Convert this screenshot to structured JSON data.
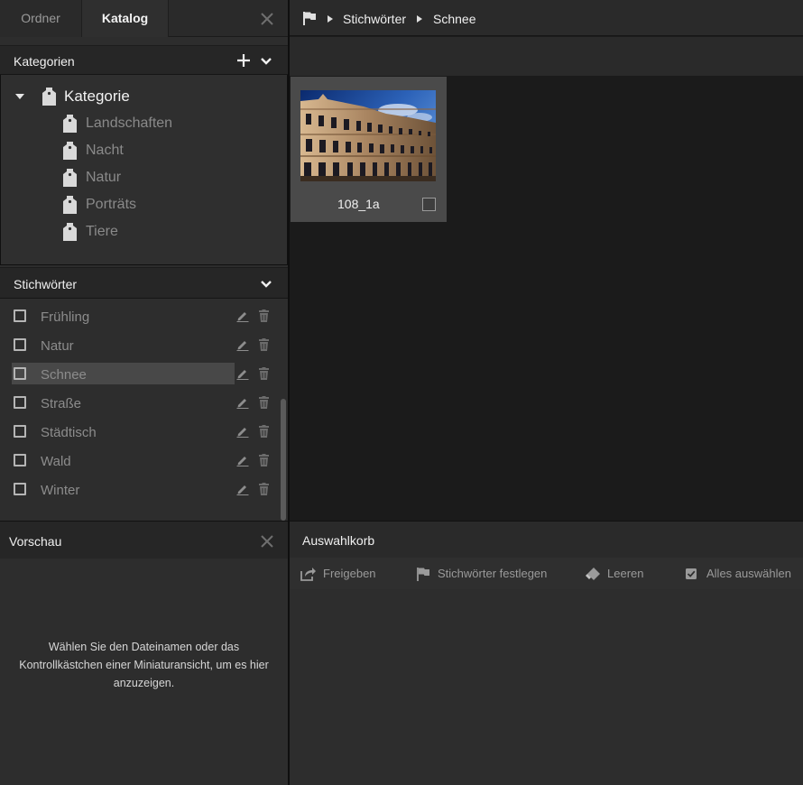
{
  "tabs": {
    "ordner": "Ordner",
    "katalog": "Katalog"
  },
  "kategorien": {
    "title": "Kategorien",
    "root": "Kategorie",
    "children": [
      "Landschaften",
      "Nacht",
      "Natur",
      "Porträts",
      "Tiere"
    ]
  },
  "stichwoerter": {
    "title": "Stichwörter",
    "items": [
      "Frühling",
      "Natur",
      "Schnee",
      "Straße",
      "Städtisch",
      "Wald",
      "Winter"
    ],
    "selected": "Schnee"
  },
  "vorschau": {
    "title": "Vorschau",
    "hint": "Wählen Sie den Dateinamen oder das Kontrollkästchen einer Miniaturansicht, um es hier anzuzeigen."
  },
  "breadcrumb": [
    "Stichwörter",
    "Schnee"
  ],
  "thumbnail": {
    "name": "108_1a"
  },
  "auswahlkorb": {
    "title": "Auswahlkorb",
    "tools": {
      "share": "Freigeben",
      "keywords": "Stichwörter festlegen",
      "clear": "Leeren",
      "select_all": "Alles auswählen"
    }
  },
  "icons": {
    "tabs_close": "close-icon",
    "add": "plus-icon",
    "collapse": "chevron-down-icon",
    "tag": "tag-icon",
    "edit": "pencil-icon",
    "delete": "trash-icon",
    "flag": "flag-icon",
    "share": "share-icon",
    "eraser": "eraser-icon",
    "checkbox": "checkbox-icon"
  },
  "colors": {
    "background": "#1b1b1b",
    "panel": "#2d2d2d",
    "header": "#262626",
    "selection": "#484848",
    "thumb_card": "#4a4a4a"
  }
}
